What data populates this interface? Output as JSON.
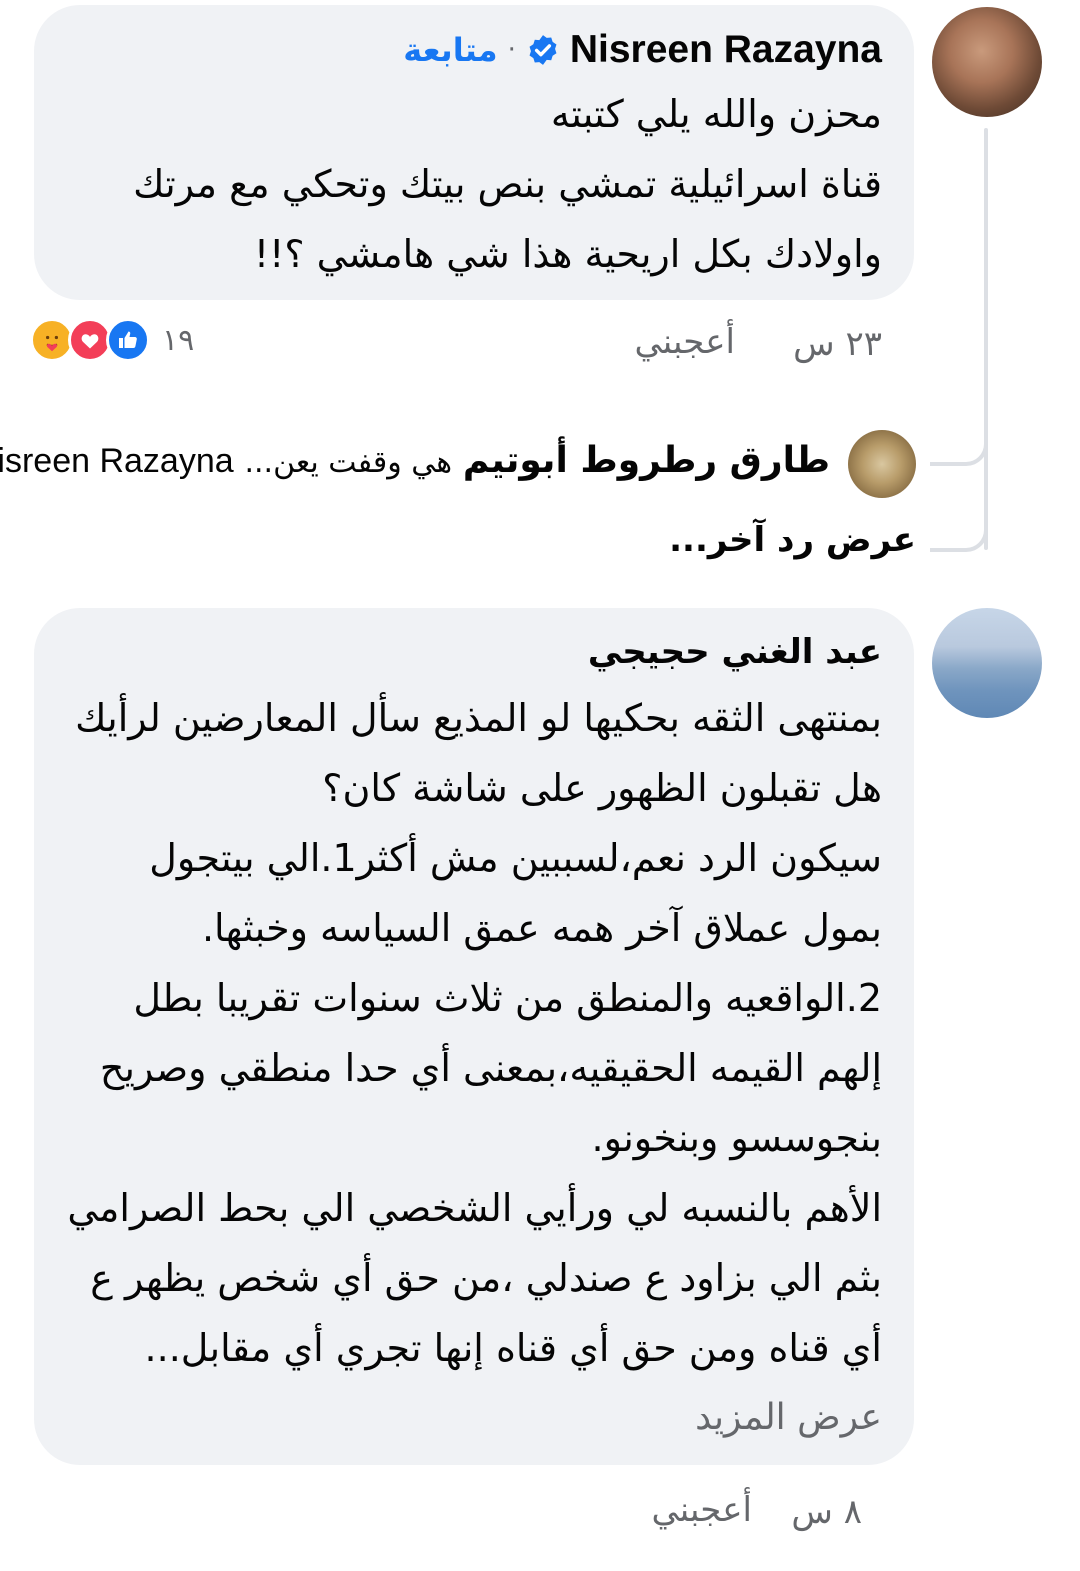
{
  "comments": [
    {
      "author": "Nisreen Razayna",
      "verified": true,
      "follow_label": "متابعة",
      "lines": [
        "محزن والله يلي كتبته",
        "قناة اسرائيلية تمشي بنص بيتك وتحكي مع مرتك",
        "واولادك بكل اريحية هذا شي هامشي ؟!!"
      ],
      "time": "٢٣ س",
      "like_label": "أعجبني",
      "reaction_count": "١٩",
      "reactions": [
        "care-icon",
        "love-icon",
        "like-icon"
      ],
      "reply_preview": {
        "author": "طارق رطروط أبوتيم",
        "text": "هي وقفت يعن...",
        "mention": "Nisreen Razayna"
      },
      "more_replies": "عرض رد آخر..."
    },
    {
      "author": "عبد الغني حجيجي",
      "lines": [
        "بمنتهى الثقه بحكيها لو المذيع سأل المعارضين لرأيك",
        "هل تقبلون الظهور على شاشة كان؟",
        "سيكون الرد نعم،لسببين مش أكثر1.الي بيتجول",
        "بمول عملاق آخر همه عمق السياسه وخبثها.",
        "2.الواقعيه والمنطق من ثلاث سنوات تقريبا بطل",
        "إلهم القيمه الحقيقيه،بمعنى أي حدا منطقي وصريح",
        "بنجوسسو وبنخونو.",
        "الأهم بالنسبه لي ورأيي الشخصي الي بحط الصرامي",
        "بثم الي بزاود ع صندلي ،من حق أي شخص يظهر ع",
        "أي قناه ومن حق أي قناه إنها تجري أي مقابل..."
      ],
      "see_more": "عرض المزيد",
      "time": "٨ س",
      "like_label": "أعجبني"
    }
  ],
  "colors": {
    "bubble": "#f0f2f5",
    "link_blue": "#1877f2",
    "secondary_text": "#65676b"
  }
}
